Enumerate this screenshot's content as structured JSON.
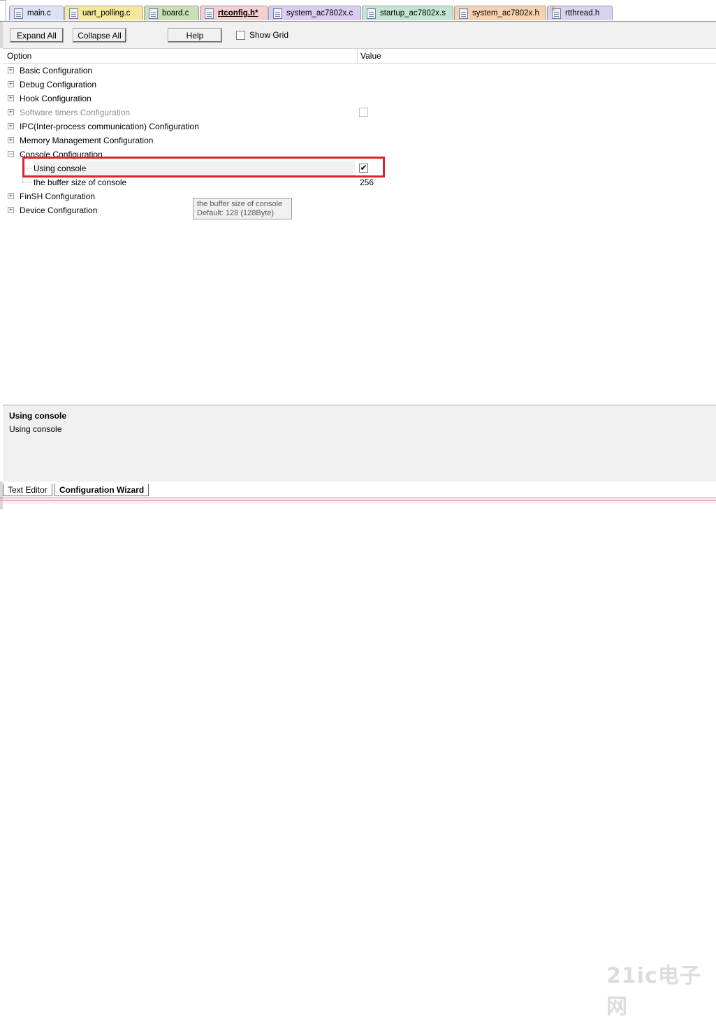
{
  "file_tabs": [
    {
      "label": "main.c",
      "color": "#dde3f7",
      "active": false,
      "icon": "file-icon"
    },
    {
      "label": "uart_polling.c",
      "color": "#f7e79b",
      "active": false,
      "icon": "file-icon"
    },
    {
      "label": "board.c",
      "color": "#c8e0b4",
      "active": false,
      "icon": "file-icon"
    },
    {
      "label": "rtconfig.h*",
      "color": "#f8cfd0",
      "active": true,
      "icon": "file-icon"
    },
    {
      "label": "system_ac7802x.c",
      "color": "#dccbf2",
      "active": false,
      "icon": "file-icon"
    },
    {
      "label": "startup_ac7802x.s",
      "color": "#c2e6d4",
      "active": false,
      "icon": "file-icon"
    },
    {
      "label": "system_ac7802x.h",
      "color": "#f8d2b0",
      "active": false,
      "icon": "file-icon"
    },
    {
      "label": "rtthread.h",
      "color": "#d6d4ee",
      "active": false,
      "icon": "header-key-icon"
    }
  ],
  "toolbar": {
    "expand_all": "Expand All",
    "collapse_all": "Collapse All",
    "help": "Help",
    "show_grid": "Show Grid",
    "show_grid_checked": false
  },
  "columns": {
    "option": "Option",
    "value": "Value"
  },
  "tree": [
    {
      "label": "Basic Configuration",
      "expand": "+",
      "indent": 0
    },
    {
      "label": "Debug Configuration",
      "expand": "+",
      "indent": 0
    },
    {
      "label": "Hook Configuration",
      "expand": "+",
      "indent": 0
    },
    {
      "label": "Software timers Configuration",
      "expand": "+",
      "indent": 0,
      "disabled": true,
      "checkbox": false
    },
    {
      "label": "IPC(Inter-process communication) Configuration",
      "expand": "+",
      "indent": 0
    },
    {
      "label": "Memory Management Configuration",
      "expand": "+",
      "indent": 0
    },
    {
      "label": "Console Configuration",
      "expand": "−",
      "indent": 0
    },
    {
      "label": "Using console",
      "indent": 1,
      "checkbox": true,
      "selected": true
    },
    {
      "label": "the buffer size of console",
      "indent": 1,
      "value": "256"
    },
    {
      "label": "FinSH Configuration",
      "expand": "+",
      "indent": 0
    },
    {
      "label": "Device Configuration",
      "expand": "+",
      "indent": 0
    }
  ],
  "tooltip": {
    "line1": "the buffer size of console",
    "line2": "Default: 128  (128Byte)"
  },
  "description": {
    "title": "Using console",
    "body": "Using console"
  },
  "bottom_tabs": [
    {
      "label": "Text Editor",
      "active": false
    },
    {
      "label": "Configuration Wizard",
      "active": true
    }
  ],
  "watermark": "21ic电子网",
  "colors": {
    "highlight": "#d8262f",
    "panel_bg": "#f0f0f0"
  }
}
